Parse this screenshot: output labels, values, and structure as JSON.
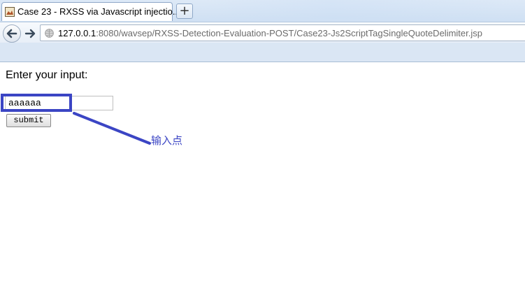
{
  "browser": {
    "tab_title": "Case 23 - RXSS via Javascript injectio...",
    "new_tab_symbol": "+",
    "url_host": "127.0.0.1",
    "url_rest": ":8080/wavsep/RXSS-Detection-Evaluation-POST/Case23-Js2ScriptTagSingleQuoteDelimiter.jsp"
  },
  "page": {
    "prompt": "Enter your input:",
    "input_value": "aaaaaa",
    "submit_label": "submit"
  },
  "annotation": {
    "label": "输入点",
    "color": "#3b45c4"
  },
  "icons": {
    "favicon": "page-favicon-icon",
    "back": "back-arrow-icon",
    "forward": "forward-arrow-icon",
    "site": "globe-icon"
  }
}
